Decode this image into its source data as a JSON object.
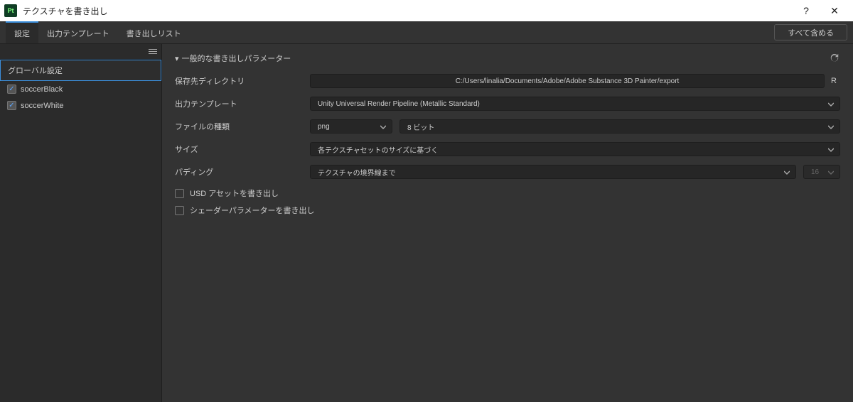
{
  "window": {
    "app_icon_text": "Pt",
    "title": "テクスチャを書き出し",
    "help": "?",
    "close": "✕"
  },
  "tabs": {
    "settings": "設定",
    "output_templates": "出力テンプレート",
    "export_list": "書き出しリスト"
  },
  "toolbar": {
    "include_all": "すべて含める"
  },
  "sidebar": {
    "header": "グローバル設定",
    "items": [
      {
        "label": "soccerBlack",
        "checked": true
      },
      {
        "label": "soccerWhite",
        "checked": true
      }
    ]
  },
  "main": {
    "section_title": "一般的な書き出しパラメーター",
    "rows": {
      "dir_label": "保存先ディレクトリ",
      "dir_value": "C:/Users/linalia/Documents/Adobe/Adobe Substance 3D Painter/export",
      "r_button": "R",
      "template_label": "出力テンプレート",
      "template_value": "Unity Universal Render Pipeline (Metallic Standard)",
      "filetype_label": "ファイルの種類",
      "filetype_value": "png",
      "bitdepth_value": "8 ビット",
      "size_label": "サイズ",
      "size_value": "各テクスチャセットのサイズに基づく",
      "padding_label": "パディング",
      "padding_value": "テクスチャの境界線まで",
      "padding_px": "16"
    },
    "checks": {
      "usd": "USD アセットを書き出し",
      "shader": "シェーダーパラメーターを書き出し"
    }
  }
}
